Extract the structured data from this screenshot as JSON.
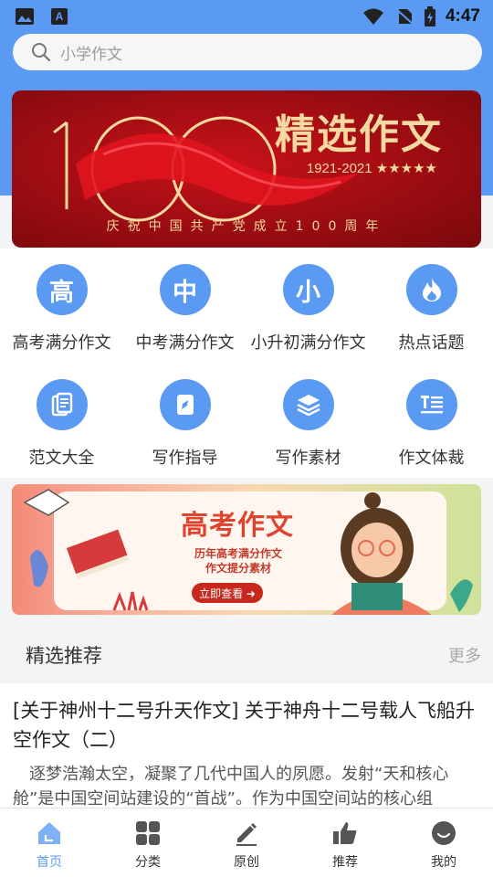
{
  "status_bar": {
    "time": "4:47",
    "icons": [
      "image-icon",
      "keyboard-a-icon",
      "wifi-icon",
      "no-sim-icon",
      "battery-icon"
    ]
  },
  "search": {
    "placeholder": "小学作文"
  },
  "banner": {
    "title": "精选作文",
    "years": "1921-2021 ★★★★★",
    "caption": "庆祝中国共产党成立100周年"
  },
  "categories": [
    {
      "label": "高考满分作文",
      "glyph": "高",
      "icon": "gao-icon"
    },
    {
      "label": "中考满分作文",
      "glyph": "中",
      "icon": "zhong-icon"
    },
    {
      "label": "小升初满分作文",
      "glyph": "小",
      "icon": "xiao-icon"
    },
    {
      "label": "热点话题",
      "glyph": "",
      "icon": "flame-icon"
    },
    {
      "label": "范文大全",
      "glyph": "",
      "icon": "documents-icon"
    },
    {
      "label": "写作指导",
      "glyph": "",
      "icon": "compass-book-icon"
    },
    {
      "label": "写作素材",
      "glyph": "",
      "icon": "layers-icon"
    },
    {
      "label": "作文体裁",
      "glyph": "",
      "icon": "text-format-icon"
    }
  ],
  "ad": {
    "title": "高考作文",
    "line1": "历年高考满分作文",
    "line2": "作文提分素材",
    "button": "立即查看 ➜"
  },
  "section": {
    "title": "精选推荐",
    "more": "更多"
  },
  "article": {
    "title": "[关于神州十二号升天作文] 关于神舟十二号载人飞船升空作文（二）",
    "body": "逐梦浩瀚太空，凝聚了几代中国人的夙愿。发射“天和核心舱”是中国空间站建设的“首战”。作为中国空间站的核心组"
  },
  "tabs": [
    {
      "label": "首页",
      "icon": "home-icon",
      "active": true
    },
    {
      "label": "分类",
      "icon": "grid-icon",
      "active": false
    },
    {
      "label": "原创",
      "icon": "pencil-icon",
      "active": false
    },
    {
      "label": "推荐",
      "icon": "thumbs-up-icon",
      "active": false
    },
    {
      "label": "我的",
      "icon": "smiley-icon",
      "active": false
    }
  ],
  "colors": {
    "primary": "#5b9af2",
    "banner_red": "#9c0d12",
    "gold": "#f4d9a0",
    "ad_red": "#e0432e"
  }
}
